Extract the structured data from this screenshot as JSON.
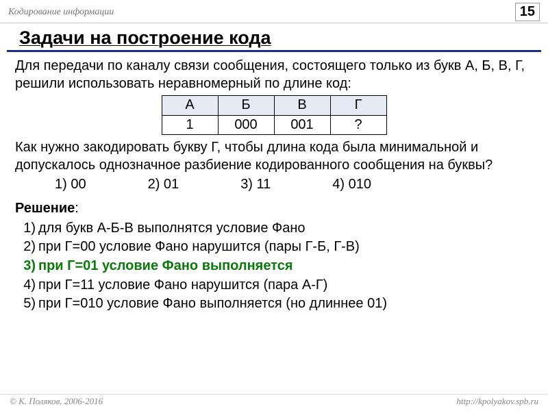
{
  "header": {
    "topic": "Кодирование информации",
    "page_number": "15"
  },
  "title": "Задачи на построение кода",
  "problem": {
    "intro": "Для передачи по каналу связи сообщения, состоящего только из букв А, Б, В, Г, решили использовать неравномерный по длине код:",
    "table": {
      "headers": [
        "А",
        "Б",
        "В",
        "Г"
      ],
      "values": [
        "1",
        "000",
        "001",
        "?"
      ]
    },
    "question": "Как нужно закодировать букву Г, чтобы длина кода была минимальной и допускалось однозначное разбиение кодированного сообщения на буквы?",
    "options": [
      "1) 00",
      "2) 01",
      "3) 11",
      "4) 010"
    ]
  },
  "solution": {
    "label": "Решение",
    "items": [
      {
        "text": "для букв А-Б-В выполнятся условие Фано",
        "correct": false
      },
      {
        "text": "при Г=00 условие Фано нарушится (пары Г-Б,  Г-В)",
        "correct": false
      },
      {
        "text": "при Г=01 условие Фано выполняется",
        "correct": true
      },
      {
        "text": "при Г=11 условие Фано нарушится (пара А-Г)",
        "correct": false
      },
      {
        "text": "при Г=010 условие Фано выполняется (но длиннее 01)",
        "correct": false
      }
    ]
  },
  "footer": {
    "copyright": "© К. Поляков, 2006-2016",
    "url": "http://kpolyakov.spb.ru"
  }
}
